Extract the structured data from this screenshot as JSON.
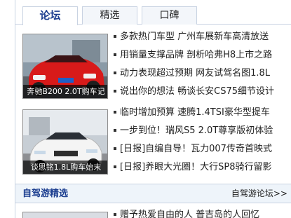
{
  "tabs": [
    "论坛",
    "精选",
    "口碑"
  ],
  "feature1": {
    "caption": "奔驰B200 2.0T购车记",
    "items": [
      "多款热门车型 广州车展新车高清放送",
      "用销量支撑品牌 剖析哈弗H8上市之路",
      "动力表现超过预期 网友试驾名图1.8L",
      "说出你的想法 畅谈长安CS75细节设计"
    ]
  },
  "feature2": {
    "caption": "谈思铭1.8L购车始末",
    "items": [
      "临时增加预算 速腾1.4TSI豪华型提车",
      "一步到位！瑞风S5 2.0T尊享版初体验",
      "[日报]自编自导！瓦力007传奇首映式",
      "[日报]养眼大光圈！大行SP8骑行留影"
    ]
  },
  "section": {
    "title": "自驾游精选",
    "more": "自驾游论坛>>"
  },
  "feature3": {
    "items": [
      "赠予热爱自由的人 普吉岛的人回忆"
    ]
  },
  "colors": {
    "accent": "#1b3d8f",
    "border": "#c9d3e2",
    "section_bg": "#eef4fa"
  }
}
